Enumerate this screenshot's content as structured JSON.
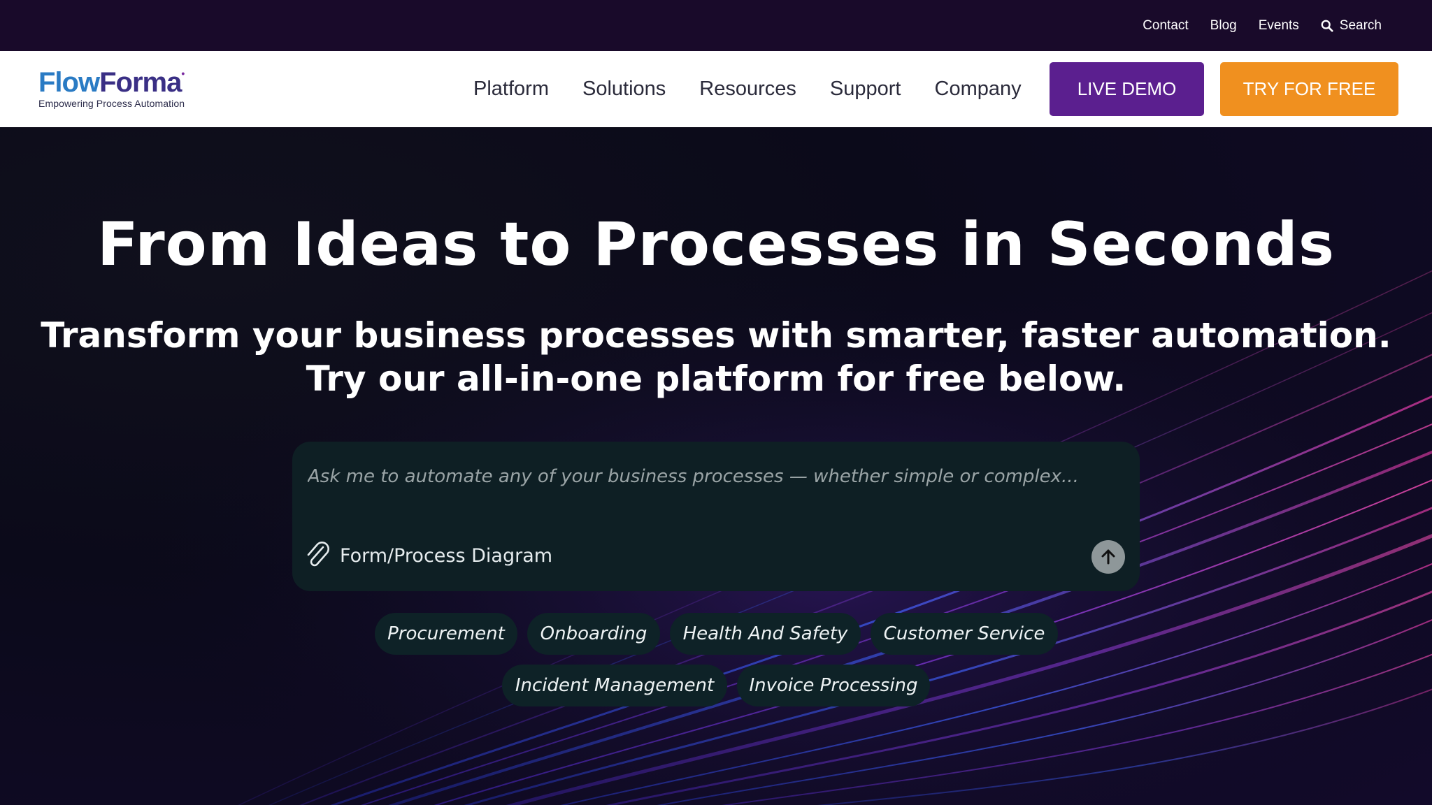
{
  "utility_nav": {
    "links": [
      "Contact",
      "Blog",
      "Events"
    ],
    "search_label": "Search"
  },
  "brand": {
    "name_part1": "Flow",
    "name_part2": "Forma",
    "tagline": "Empowering Process Automation"
  },
  "main_nav": {
    "items": [
      "Platform",
      "Solutions",
      "Resources",
      "Support",
      "Company"
    ]
  },
  "cta": {
    "demo_label": "LIVE DEMO",
    "free_label": "TRY FOR FREE"
  },
  "hero": {
    "title": "From Ideas to Processes in Seconds",
    "subtitle_line1": "Transform your business processes with smarter, faster automation.",
    "subtitle_line2": "Try our all-in-one platform for free below."
  },
  "prompt": {
    "placeholder": "Ask me to automate any of your business processes — whether simple or complex...",
    "value": "",
    "attach_label": "Form/Process Diagram"
  },
  "suggestions": [
    "Procurement",
    "Onboarding",
    "Health And Safety",
    "Customer Service",
    "Incident Management",
    "Invoice Processing"
  ],
  "colors": {
    "utility_bg": "#190a2a",
    "demo_button": "#5b1f8f",
    "free_button": "#f0901f",
    "prompt_bg": "#0e1f24"
  }
}
